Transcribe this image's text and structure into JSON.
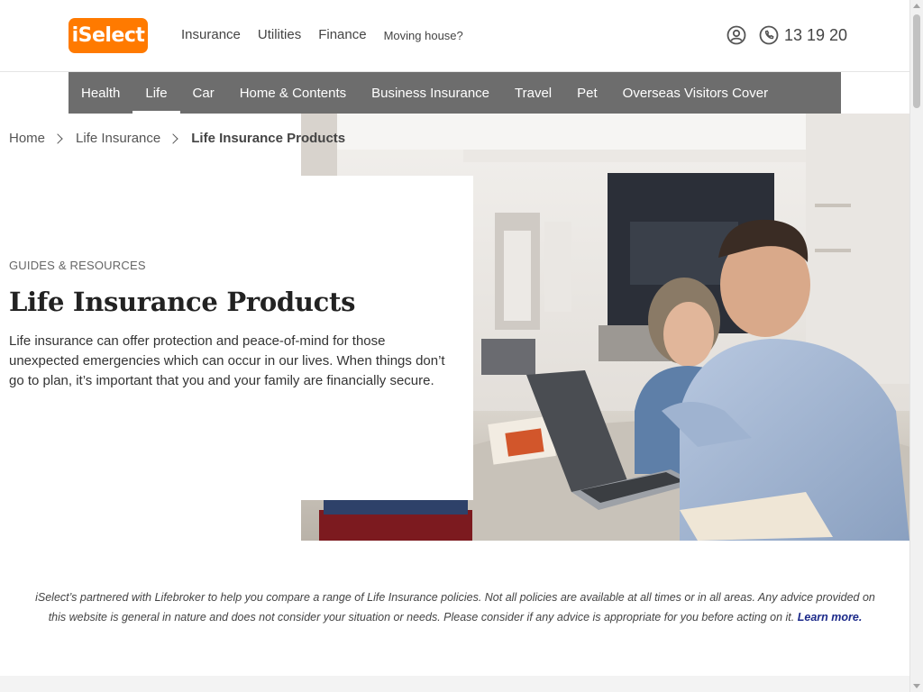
{
  "header": {
    "logo_text": "iSelect",
    "nav": [
      {
        "label": "Insurance"
      },
      {
        "label": "Utilities"
      },
      {
        "label": "Finance"
      },
      {
        "label": "Moving house?"
      }
    ],
    "account_icon": "account-icon",
    "phone_icon": "phone-icon",
    "phone_number": "13 19 20"
  },
  "category_nav": {
    "items": [
      {
        "label": "Health"
      },
      {
        "label": "Life",
        "active": true
      },
      {
        "label": "Car"
      },
      {
        "label": "Home & Contents"
      },
      {
        "label": "Business Insurance"
      },
      {
        "label": "Travel"
      },
      {
        "label": "Pet"
      },
      {
        "label": "Overseas Visitors Cover"
      }
    ]
  },
  "breadcrumb": {
    "items": [
      "Home",
      "Life Insurance"
    ],
    "current": "Life Insurance Products"
  },
  "hero": {
    "eyebrow": "GUIDES & RESOURCES",
    "title": "Life Insurance Products",
    "description": "Life insurance can offer protection and peace-of-mind for those unexpected emergencies which can occur in our lives. When things don’t go to plan, it’s important that you and your family are financially secure."
  },
  "disclaimer": {
    "text": "iSelect’s partnered with Lifebroker to help you compare a range of Life Insurance policies. Not all policies are available at all times or in all areas. Any advice provided on this website is general in nature and does not consider your situation or needs. Please consider if any advice is appropriate for you before acting on it. ",
    "link": "Learn more."
  },
  "colors": {
    "brand_orange": "#ff7a00",
    "nav_grey": "#6d6d6d",
    "link_blue": "#1c2a8a"
  }
}
